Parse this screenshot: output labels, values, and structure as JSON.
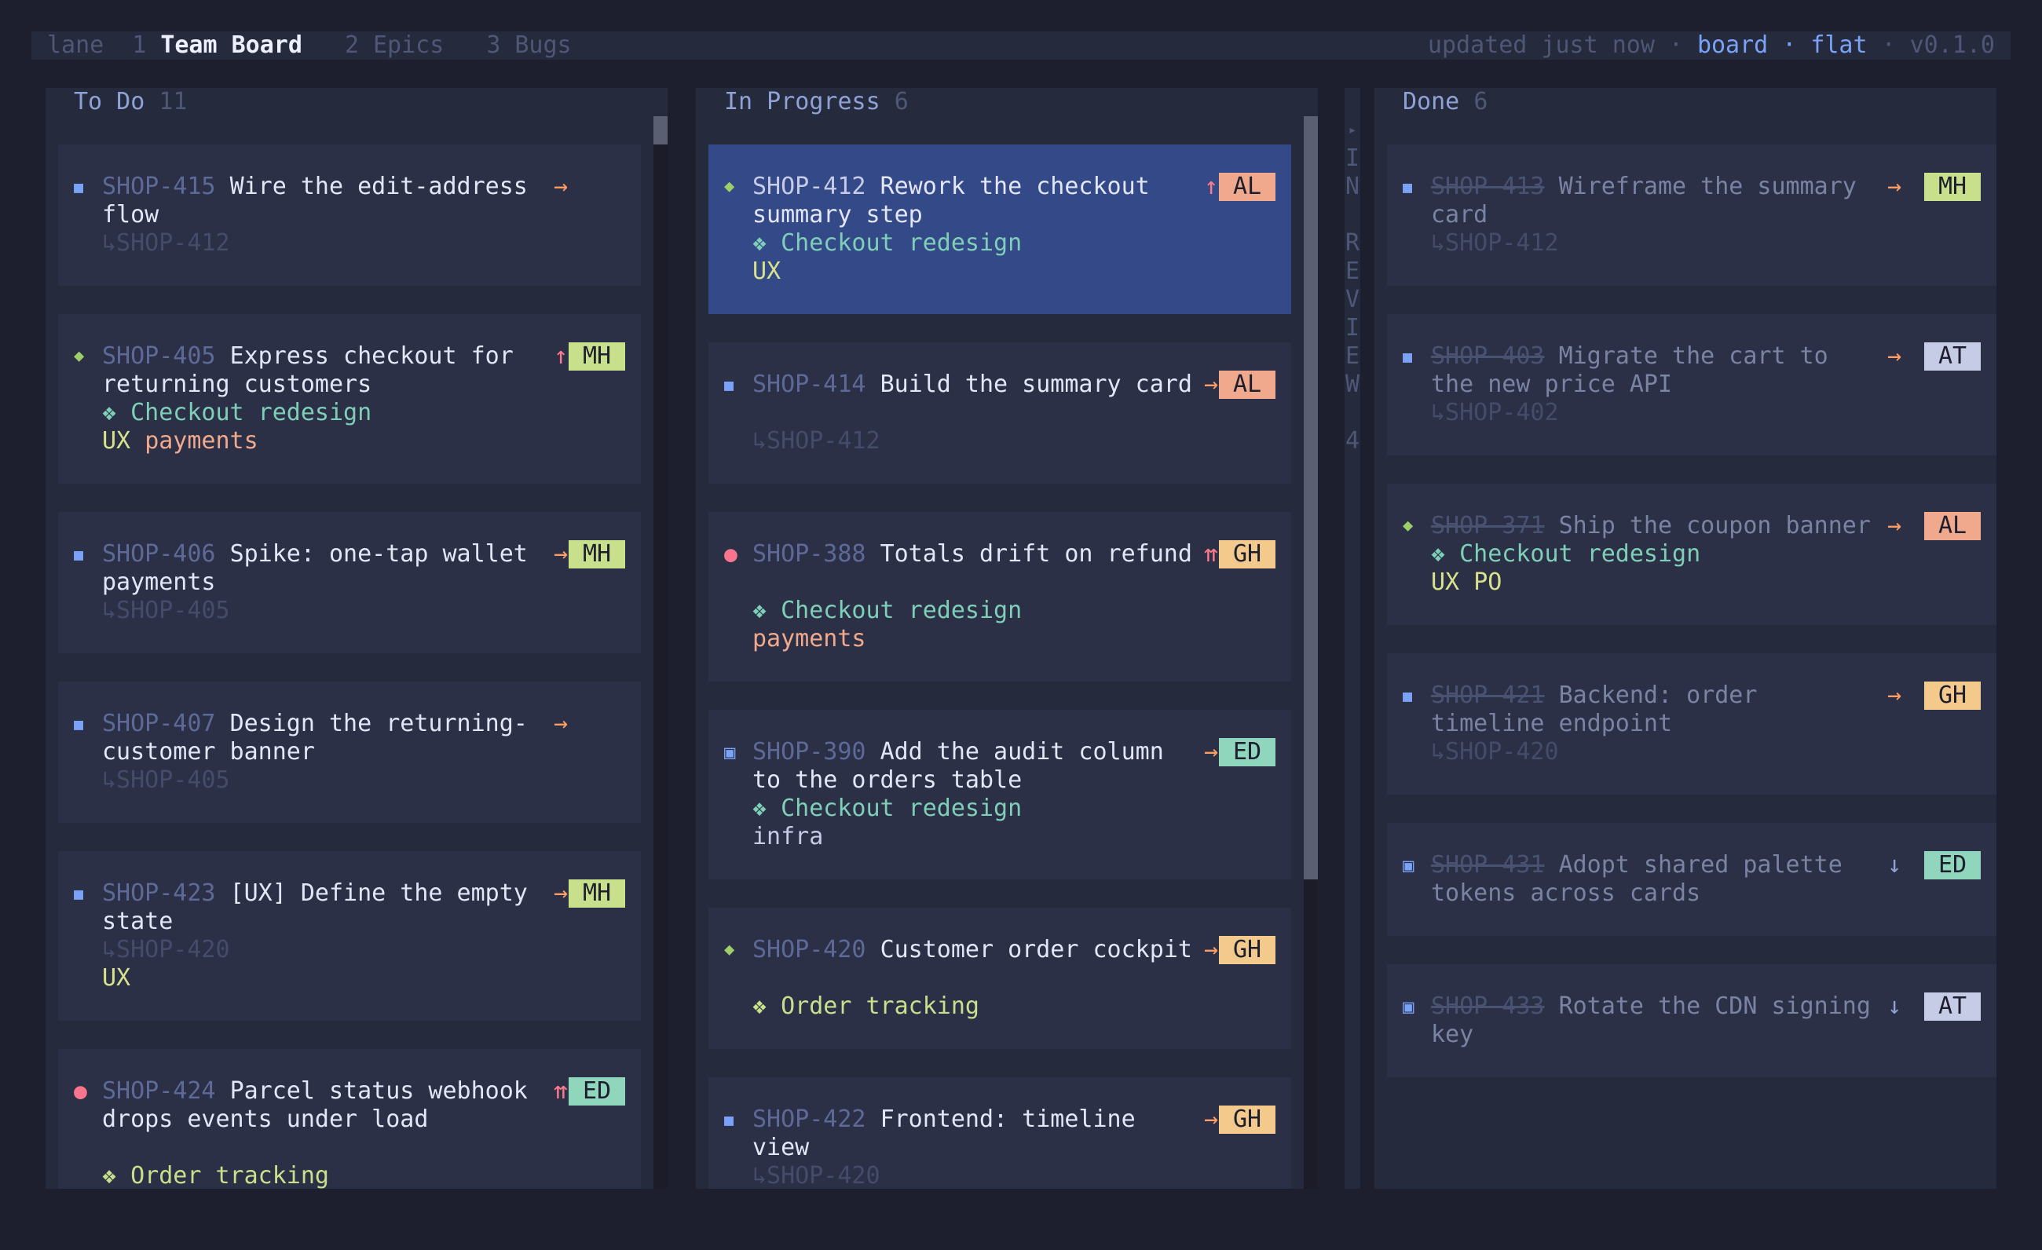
{
  "topbar": {
    "prefix": "lane",
    "tabs": [
      {
        "num": "1",
        "label": "Team Board",
        "active": true
      },
      {
        "num": "2",
        "label": "Epics",
        "active": false
      },
      {
        "num": "3",
        "label": "Bugs",
        "active": false
      }
    ],
    "status": "updated just now",
    "sep": "·",
    "view_mode": "board",
    "layout_mode": "flat",
    "version": "v0.1.0"
  },
  "columns": {
    "todo": {
      "title": "To Do",
      "count": "11"
    },
    "progress": {
      "title": "In Progress",
      "count": "6"
    },
    "review": {
      "letters": [
        "I",
        "N",
        "",
        "R",
        "E",
        "V",
        "I",
        "E",
        "W",
        "",
        "4"
      ],
      "arrow": "▸"
    },
    "done": {
      "title": "Done",
      "count": "6"
    }
  },
  "colors": {
    "badge_AL": "#f0a98c",
    "badge_MH": "#c8e08c",
    "badge_ED": "#8fd6bd",
    "badge_GH": "#f3c98c",
    "badge_AT": "#c6cbe6",
    "selected": "#344a88"
  },
  "icons": {
    "story": "square-icon",
    "epic": "diamond-icon",
    "bug": "circle-icon",
    "task": "boxed-square-icon",
    "epic_link": "epic-link-icon"
  },
  "todo_cards": [
    {
      "key": "SHOP-415",
      "title1": "Wire the edit-address",
      "title2": "flow",
      "parent": "↳SHOP-412",
      "prio": "→"
    },
    {
      "key": "SHOP-405",
      "title1": "Express checkout for",
      "title2": "returning customers",
      "epic": "❖ Checkout redesign",
      "l1": "UX",
      "l2": "payments",
      "prio": "↑",
      "badge": "MH"
    },
    {
      "key": "SHOP-406",
      "title1": "Spike: one-tap wallet",
      "title2": "payments",
      "parent": "↳SHOP-405",
      "prio": "→",
      "badge": "MH"
    },
    {
      "key": "SHOP-407",
      "title1": "Design the returning-",
      "title2": "customer banner",
      "parent": "↳SHOP-405",
      "prio": "→"
    },
    {
      "key": "SHOP-423",
      "title1": "[UX] Define the empty",
      "title2": "state",
      "parent": "↳SHOP-420",
      "l1": "UX",
      "prio": "→",
      "badge": "MH"
    },
    {
      "key": "SHOP-424",
      "title1": "Parcel status webhook",
      "title2": "drops events under load",
      "epic": "❖ Order tracking",
      "prio": "⇈",
      "badge": "ED"
    }
  ],
  "progress_cards": [
    {
      "key": "SHOP-412",
      "title1": "Rework the checkout",
      "title2": "summary step",
      "epic": "❖ Checkout redesign",
      "l1": "UX",
      "prio": "↑",
      "badge": "AL"
    },
    {
      "key": "SHOP-414",
      "title1": "Build the summary card",
      "parent": "↳SHOP-412",
      "prio": "→",
      "badge": "AL"
    },
    {
      "key": "SHOP-388",
      "title1": "Totals drift on refund",
      "epic": "❖ Checkout redesign",
      "l1": "payments",
      "prio": "⇈",
      "badge": "GH"
    },
    {
      "key": "SHOP-390",
      "title1": "Add the audit column",
      "title2": "to the orders table",
      "epic": "❖ Checkout redesign",
      "l1": "infra",
      "prio": "→",
      "badge": "ED"
    },
    {
      "key": "SHOP-420",
      "title1": "Customer order cockpit",
      "epic": "❖ Order tracking",
      "prio": "→",
      "badge": "GH"
    },
    {
      "key": "SHOP-422",
      "title1": "Frontend: timeline",
      "title2": "view",
      "parent": "↳SHOP-420",
      "prio": "→",
      "badge": "GH"
    }
  ],
  "done_cards": [
    {
      "key": "SHOP-413",
      "title1": "Wireframe the summary",
      "title2": "card",
      "parent": "↳SHOP-412",
      "prio": "→",
      "badge": "MH"
    },
    {
      "key": "SHOP-403",
      "title1": "Migrate the cart to",
      "title2": "the new price API",
      "parent": "↳SHOP-402",
      "prio": "→",
      "badge": "AT"
    },
    {
      "key": "SHOP-371",
      "title1": "Ship the coupon banner",
      "epic": "❖ Checkout redesign",
      "l1": "UX",
      "l2": "PO",
      "prio": "→",
      "badge": "AL"
    },
    {
      "key": "SHOP-421",
      "title1": "Backend: order",
      "title2": "timeline endpoint",
      "parent": "↳SHOP-420",
      "prio": "→",
      "badge": "GH"
    },
    {
      "key": "SHOP-431",
      "title1": "Adopt shared palette",
      "title2": "tokens across cards",
      "prio": "↓",
      "badge": "ED"
    },
    {
      "key": "SHOP-433",
      "title1": "Rotate the CDN signing",
      "title2": "key",
      "prio": "↓",
      "badge": "AT"
    }
  ]
}
